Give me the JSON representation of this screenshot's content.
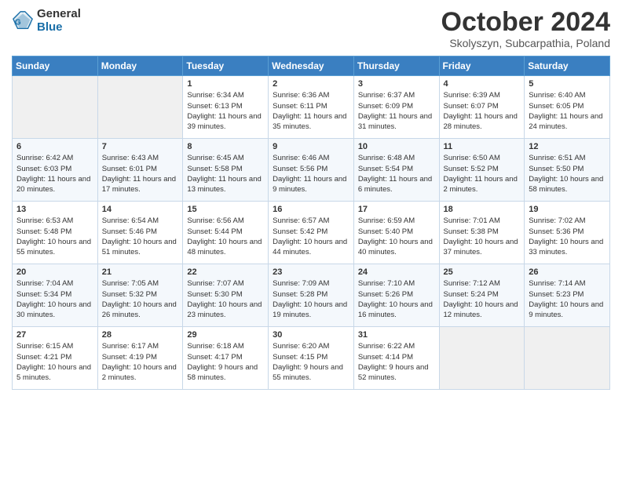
{
  "header": {
    "logo": {
      "line1": "General",
      "line2": "Blue"
    },
    "title": "October 2024",
    "location": "Skolyszyn, Subcarpathia, Poland"
  },
  "weekdays": [
    "Sunday",
    "Monday",
    "Tuesday",
    "Wednesday",
    "Thursday",
    "Friday",
    "Saturday"
  ],
  "weeks": [
    [
      {
        "day": "",
        "sunrise": "",
        "sunset": "",
        "daylight": ""
      },
      {
        "day": "",
        "sunrise": "",
        "sunset": "",
        "daylight": ""
      },
      {
        "day": "1",
        "sunrise": "Sunrise: 6:34 AM",
        "sunset": "Sunset: 6:13 PM",
        "daylight": "Daylight: 11 hours and 39 minutes."
      },
      {
        "day": "2",
        "sunrise": "Sunrise: 6:36 AM",
        "sunset": "Sunset: 6:11 PM",
        "daylight": "Daylight: 11 hours and 35 minutes."
      },
      {
        "day": "3",
        "sunrise": "Sunrise: 6:37 AM",
        "sunset": "Sunset: 6:09 PM",
        "daylight": "Daylight: 11 hours and 31 minutes."
      },
      {
        "day": "4",
        "sunrise": "Sunrise: 6:39 AM",
        "sunset": "Sunset: 6:07 PM",
        "daylight": "Daylight: 11 hours and 28 minutes."
      },
      {
        "day": "5",
        "sunrise": "Sunrise: 6:40 AM",
        "sunset": "Sunset: 6:05 PM",
        "daylight": "Daylight: 11 hours and 24 minutes."
      }
    ],
    [
      {
        "day": "6",
        "sunrise": "Sunrise: 6:42 AM",
        "sunset": "Sunset: 6:03 PM",
        "daylight": "Daylight: 11 hours and 20 minutes."
      },
      {
        "day": "7",
        "sunrise": "Sunrise: 6:43 AM",
        "sunset": "Sunset: 6:01 PM",
        "daylight": "Daylight: 11 hours and 17 minutes."
      },
      {
        "day": "8",
        "sunrise": "Sunrise: 6:45 AM",
        "sunset": "Sunset: 5:58 PM",
        "daylight": "Daylight: 11 hours and 13 minutes."
      },
      {
        "day": "9",
        "sunrise": "Sunrise: 6:46 AM",
        "sunset": "Sunset: 5:56 PM",
        "daylight": "Daylight: 11 hours and 9 minutes."
      },
      {
        "day": "10",
        "sunrise": "Sunrise: 6:48 AM",
        "sunset": "Sunset: 5:54 PM",
        "daylight": "Daylight: 11 hours and 6 minutes."
      },
      {
        "day": "11",
        "sunrise": "Sunrise: 6:50 AM",
        "sunset": "Sunset: 5:52 PM",
        "daylight": "Daylight: 11 hours and 2 minutes."
      },
      {
        "day": "12",
        "sunrise": "Sunrise: 6:51 AM",
        "sunset": "Sunset: 5:50 PM",
        "daylight": "Daylight: 10 hours and 58 minutes."
      }
    ],
    [
      {
        "day": "13",
        "sunrise": "Sunrise: 6:53 AM",
        "sunset": "Sunset: 5:48 PM",
        "daylight": "Daylight: 10 hours and 55 minutes."
      },
      {
        "day": "14",
        "sunrise": "Sunrise: 6:54 AM",
        "sunset": "Sunset: 5:46 PM",
        "daylight": "Daylight: 10 hours and 51 minutes."
      },
      {
        "day": "15",
        "sunrise": "Sunrise: 6:56 AM",
        "sunset": "Sunset: 5:44 PM",
        "daylight": "Daylight: 10 hours and 48 minutes."
      },
      {
        "day": "16",
        "sunrise": "Sunrise: 6:57 AM",
        "sunset": "Sunset: 5:42 PM",
        "daylight": "Daylight: 10 hours and 44 minutes."
      },
      {
        "day": "17",
        "sunrise": "Sunrise: 6:59 AM",
        "sunset": "Sunset: 5:40 PM",
        "daylight": "Daylight: 10 hours and 40 minutes."
      },
      {
        "day": "18",
        "sunrise": "Sunrise: 7:01 AM",
        "sunset": "Sunset: 5:38 PM",
        "daylight": "Daylight: 10 hours and 37 minutes."
      },
      {
        "day": "19",
        "sunrise": "Sunrise: 7:02 AM",
        "sunset": "Sunset: 5:36 PM",
        "daylight": "Daylight: 10 hours and 33 minutes."
      }
    ],
    [
      {
        "day": "20",
        "sunrise": "Sunrise: 7:04 AM",
        "sunset": "Sunset: 5:34 PM",
        "daylight": "Daylight: 10 hours and 30 minutes."
      },
      {
        "day": "21",
        "sunrise": "Sunrise: 7:05 AM",
        "sunset": "Sunset: 5:32 PM",
        "daylight": "Daylight: 10 hours and 26 minutes."
      },
      {
        "day": "22",
        "sunrise": "Sunrise: 7:07 AM",
        "sunset": "Sunset: 5:30 PM",
        "daylight": "Daylight: 10 hours and 23 minutes."
      },
      {
        "day": "23",
        "sunrise": "Sunrise: 7:09 AM",
        "sunset": "Sunset: 5:28 PM",
        "daylight": "Daylight: 10 hours and 19 minutes."
      },
      {
        "day": "24",
        "sunrise": "Sunrise: 7:10 AM",
        "sunset": "Sunset: 5:26 PM",
        "daylight": "Daylight: 10 hours and 16 minutes."
      },
      {
        "day": "25",
        "sunrise": "Sunrise: 7:12 AM",
        "sunset": "Sunset: 5:24 PM",
        "daylight": "Daylight: 10 hours and 12 minutes."
      },
      {
        "day": "26",
        "sunrise": "Sunrise: 7:14 AM",
        "sunset": "Sunset: 5:23 PM",
        "daylight": "Daylight: 10 hours and 9 minutes."
      }
    ],
    [
      {
        "day": "27",
        "sunrise": "Sunrise: 6:15 AM",
        "sunset": "Sunset: 4:21 PM",
        "daylight": "Daylight: 10 hours and 5 minutes."
      },
      {
        "day": "28",
        "sunrise": "Sunrise: 6:17 AM",
        "sunset": "Sunset: 4:19 PM",
        "daylight": "Daylight: 10 hours and 2 minutes."
      },
      {
        "day": "29",
        "sunrise": "Sunrise: 6:18 AM",
        "sunset": "Sunset: 4:17 PM",
        "daylight": "Daylight: 9 hours and 58 minutes."
      },
      {
        "day": "30",
        "sunrise": "Sunrise: 6:20 AM",
        "sunset": "Sunset: 4:15 PM",
        "daylight": "Daylight: 9 hours and 55 minutes."
      },
      {
        "day": "31",
        "sunrise": "Sunrise: 6:22 AM",
        "sunset": "Sunset: 4:14 PM",
        "daylight": "Daylight: 9 hours and 52 minutes."
      },
      {
        "day": "",
        "sunrise": "",
        "sunset": "",
        "daylight": ""
      },
      {
        "day": "",
        "sunrise": "",
        "sunset": "",
        "daylight": ""
      }
    ]
  ]
}
